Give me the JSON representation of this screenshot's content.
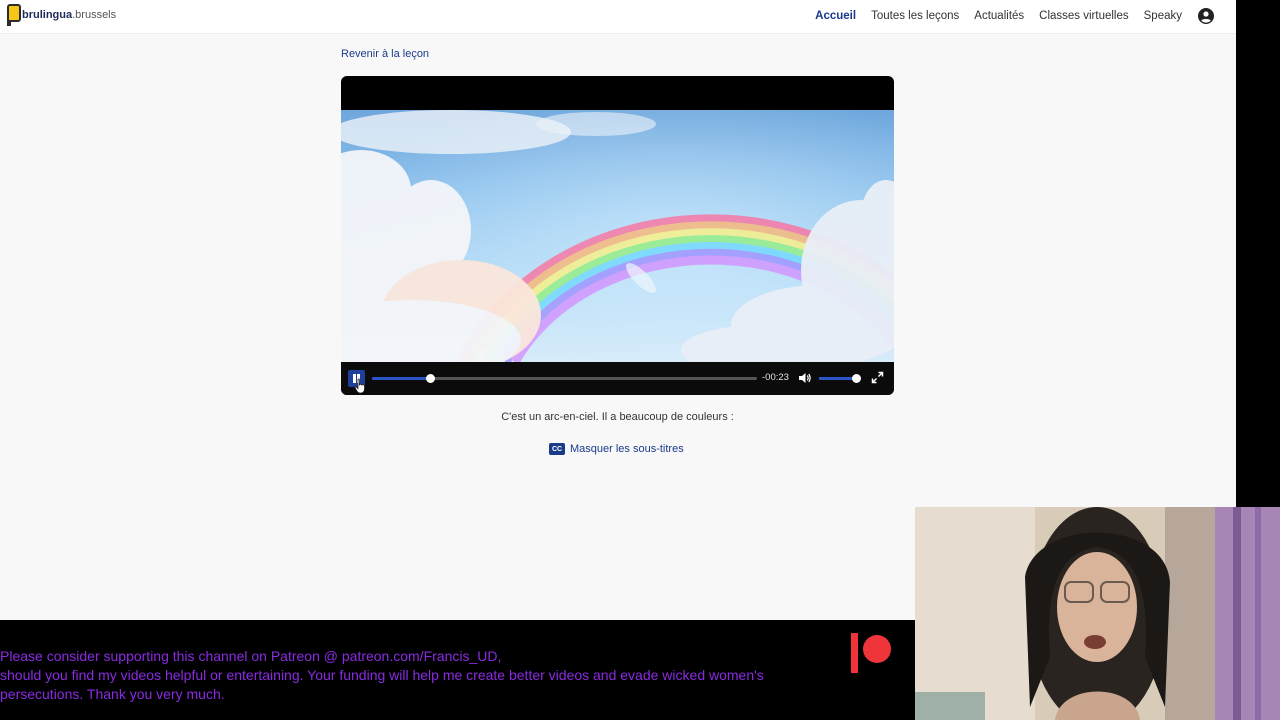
{
  "site": {
    "logo": {
      "name": "brulingua",
      "suffix": ".brussels"
    },
    "nav": [
      "Accueil",
      "Toutes les leçons",
      "Actualités",
      "Classes virtuelles",
      "Speaky"
    ],
    "active_nav": "Accueil"
  },
  "back_link": "Revenir à la leçon",
  "player": {
    "remaining_time": "-00:23",
    "progress": 0.15,
    "volume": 0.92,
    "state": "playing"
  },
  "caption": "C'est un arc-en-ciel. Il a beaucoup de couleurs :",
  "subtitles": {
    "badge": "CC",
    "label": "Masquer les sous-titres"
  },
  "banner": {
    "lines": [
      "Please consider supporting this channel on Patreon @ patreon.com/Francis_UD,",
      "should you find my videos helpful or entertaining. Your funding will help me create better videos and evade wicked women's",
      "persecutions.  Thank you very much."
    ],
    "text_color": "#8a2be2",
    "logo_color": "#f0353a"
  },
  "colors": {
    "accent": "#1a3a8a",
    "player_accent": "#2b55c9"
  }
}
